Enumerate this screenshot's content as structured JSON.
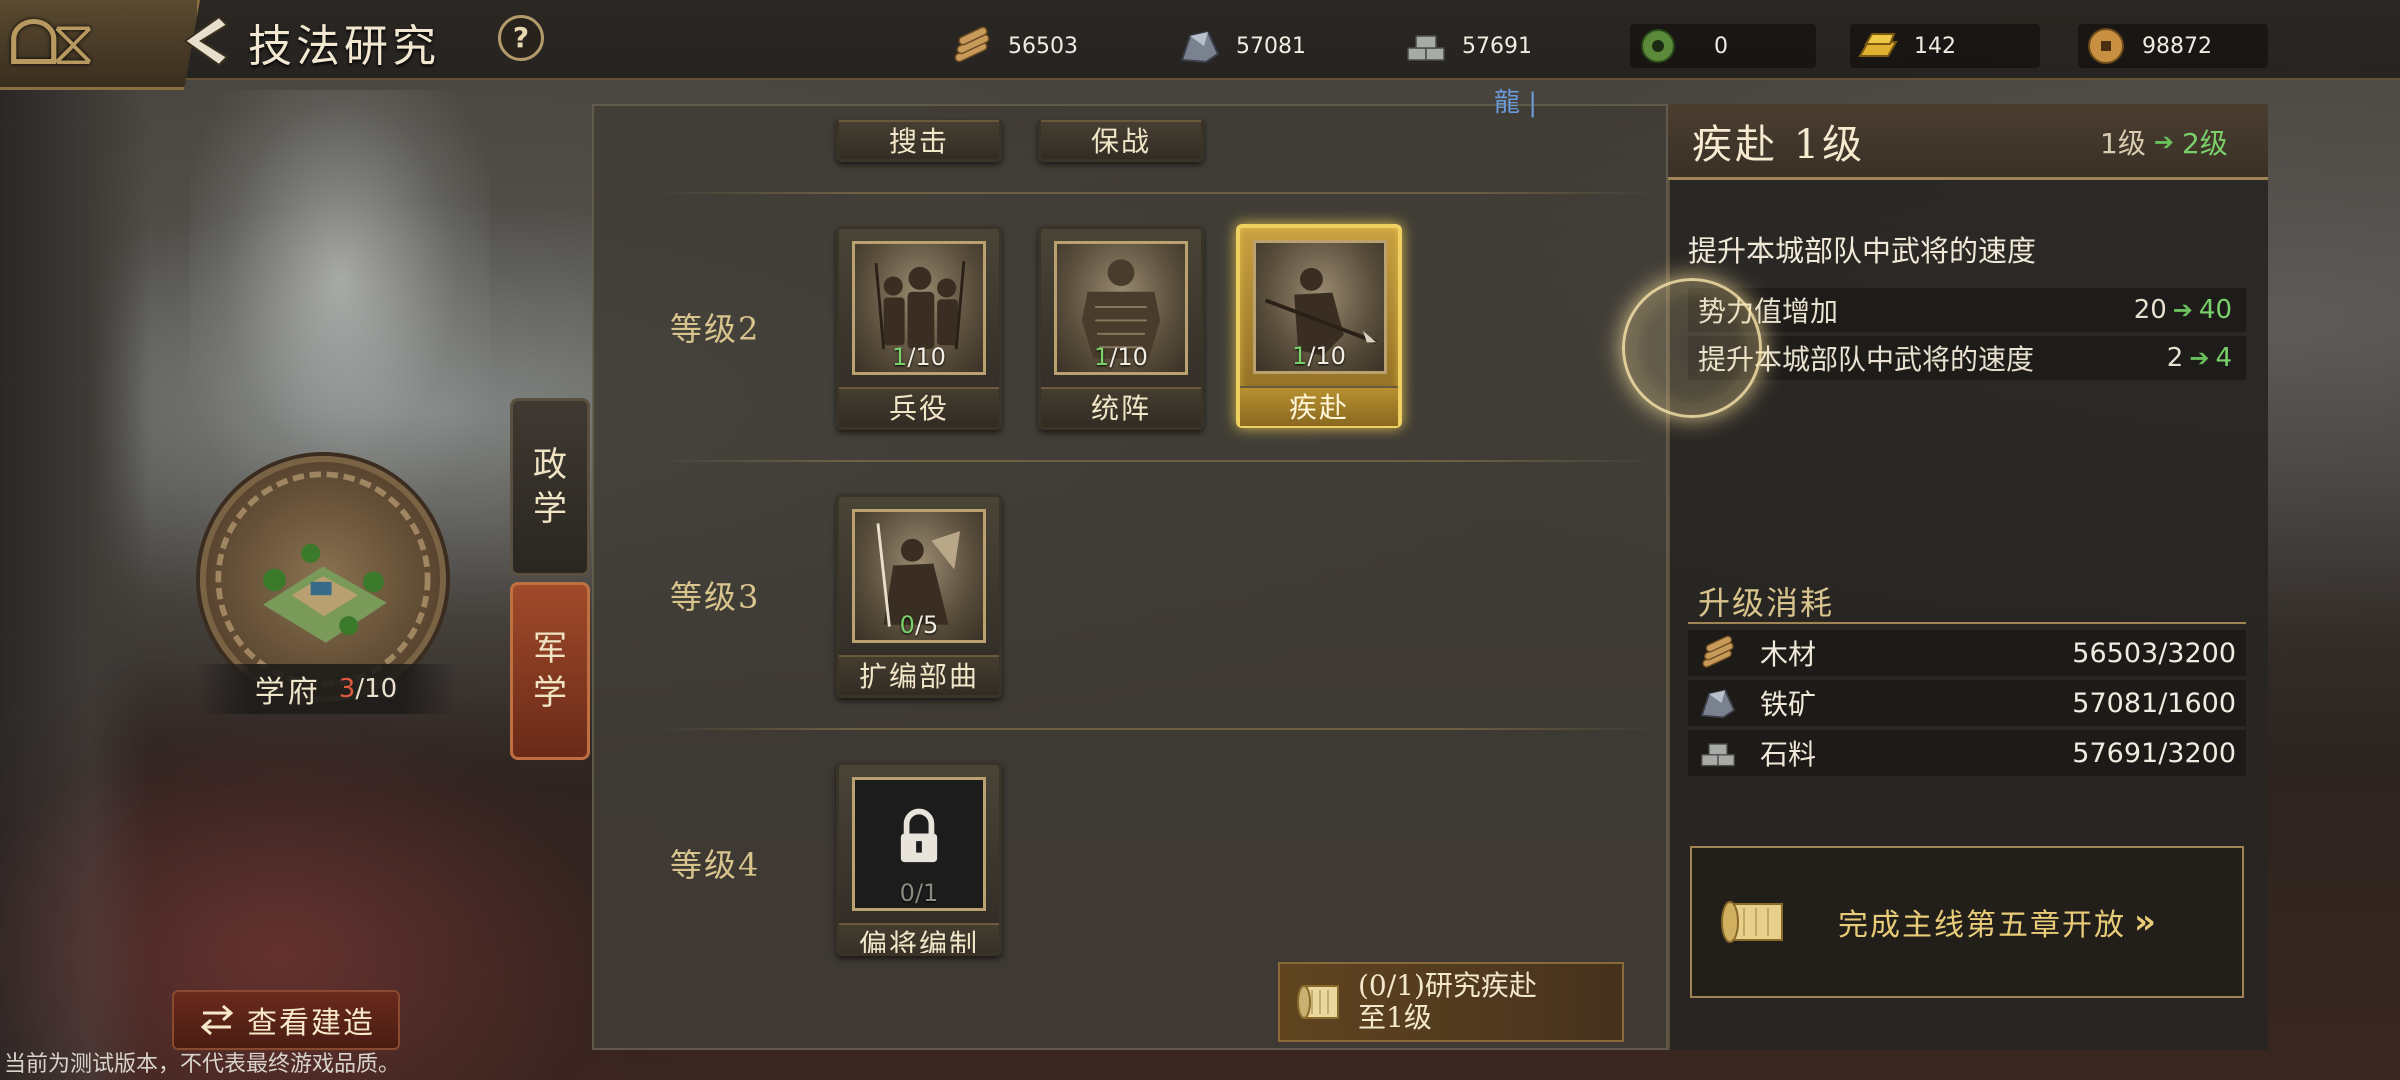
{
  "header": {
    "title": "技法研究",
    "help_label": "?"
  },
  "resources": [
    {
      "name": "wood-icon",
      "value": "56503"
    },
    {
      "name": "iron-icon",
      "value": "57081"
    },
    {
      "name": "stone-icon",
      "value": "57691"
    },
    {
      "name": "jade-icon",
      "value": "0"
    },
    {
      "name": "gold-icon",
      "value": "142"
    },
    {
      "name": "coin-icon",
      "value": "98872"
    }
  ],
  "server_label": "龍 |",
  "tabs": [
    {
      "label_top": "政",
      "label_bottom": "学",
      "active": false
    },
    {
      "label_top": "军",
      "label_bottom": "学",
      "active": true
    }
  ],
  "academy": {
    "name": "学府",
    "current": "3",
    "total": "/10"
  },
  "view_build_label": "查看建造",
  "disclaimer": "当前为测试版本，不代表最终游戏品质。",
  "partial_cards": [
    "搜击",
    "保战"
  ],
  "levels": [
    {
      "label": "等级2",
      "skills": [
        {
          "name": "兵役",
          "current": "1",
          "max": "/10"
        },
        {
          "name": "统阵",
          "current": "1",
          "max": "/10"
        },
        {
          "name": "疾赴",
          "current": "1",
          "max": "/10",
          "selected": true
        }
      ]
    },
    {
      "label": "等级3",
      "skills": [
        {
          "name": "扩编部曲",
          "current": "0",
          "max": "/5"
        }
      ]
    },
    {
      "label": "等级4",
      "skills": [
        {
          "name": "偏将编制",
          "current": "0",
          "max": "/1",
          "locked": true
        }
      ]
    }
  ],
  "task": {
    "line1": "(0/1)研究疾赴",
    "line2": "至1级"
  },
  "detail": {
    "title": "疾赴 1级",
    "level_from": "1级",
    "level_to": "2级",
    "description": "提升本城部队中武将的速度",
    "stats": [
      {
        "label": "势力值增加",
        "from": "20",
        "to": "40"
      },
      {
        "label": "提升本城部队中武将的速度",
        "from": "2",
        "to": "4"
      }
    ],
    "cost_title": "升级消耗",
    "costs": [
      {
        "icon": "wood-icon",
        "label": "木材",
        "value": "56503/3200"
      },
      {
        "icon": "iron-icon",
        "label": "铁矿",
        "value": "57081/1600"
      },
      {
        "icon": "stone-icon",
        "label": "石料",
        "value": "57691/3200"
      }
    ],
    "unlock_text": "完成主线第五章开放",
    "unlock_chevron": "»"
  },
  "colors": {
    "accent_gold": "#d8c48c",
    "increase_green": "#7ad06a",
    "active_tab_red": "#a04a2a",
    "selected_border": "#f0d060"
  }
}
